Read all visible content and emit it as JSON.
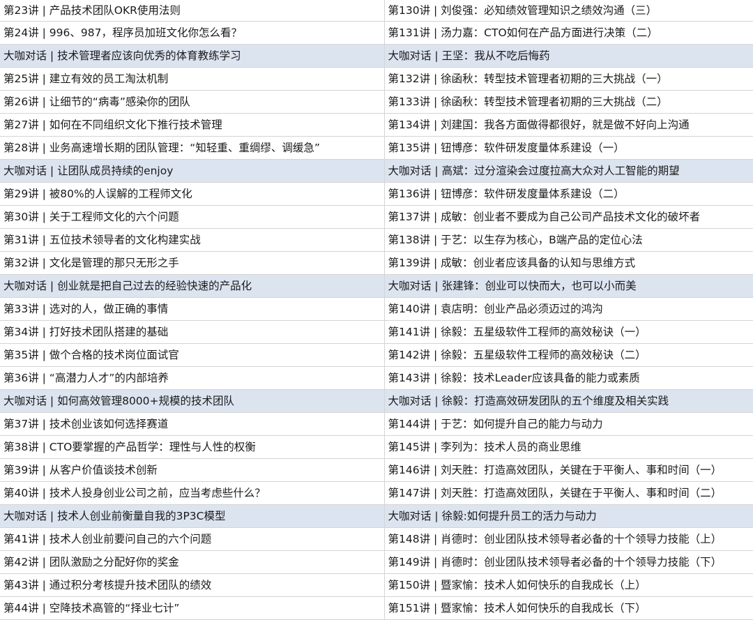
{
  "rows": [
    {
      "left": "第23讲 | 产品技术团队OKR使用法则",
      "right": "第130讲 | 刘俊强：必知绩效管理知识之绩效沟通（三）",
      "highlight": false
    },
    {
      "left": "第24讲 | 996、987，程序员加班文化你怎么看？",
      "right": "第131讲 | 汤力嘉：CTO如何在产品方面进行决策（二）",
      "highlight": false
    },
    {
      "left": "大咖对话 | 技术管理者应该向优秀的体育教练学习",
      "right": "大咖对话 | 王坚：我从不吃后悔药",
      "highlight": true
    },
    {
      "left": "第25讲 | 建立有效的员工淘汰机制",
      "right": "第132讲 | 徐函秋：转型技术管理者初期的三大挑战（一）",
      "highlight": false
    },
    {
      "left": "第26讲 | 让细节的“病毒”感染你的团队",
      "right": "第133讲 | 徐函秋：转型技术管理者初期的三大挑战（二）",
      "highlight": false
    },
    {
      "left": "第27讲 | 如何在不同组织文化下推行技术管理",
      "right": "第134讲 | 刘建国：我各方面做得都很好，就是做不好向上沟通",
      "highlight": false
    },
    {
      "left": "第28讲 | 业务高速增长期的团队管理：“知轻重、重绸缪、调缓急”",
      "right": "第135讲 | 钮博彦：软件研发度量体系建设（一）",
      "highlight": false
    },
    {
      "left": "大咖对话 | 让团队成员持续的enjoy",
      "right": "大咖对话 | 高斌：过分渲染会过度拉高大众对人工智能的期望",
      "highlight": true
    },
    {
      "left": "第29讲 | 被80%的人误解的工程师文化",
      "right": "第136讲 | 钮博彦：软件研发度量体系建设（二）",
      "highlight": false
    },
    {
      "left": "第30讲 | 关于工程师文化的六个问题",
      "right": "第137讲 | 成敏：创业者不要成为自己公司产品技术文化的破坏者",
      "highlight": false
    },
    {
      "left": "第31讲 | 五位技术领导者的文化构建实战",
      "right": "第138讲 | 于艺：以生存为核心，B端产品的定位心法",
      "highlight": false
    },
    {
      "left": "第32讲 | 文化是管理的那只无形之手",
      "right": "第139讲 | 成敏：创业者应该具备的认知与思维方式",
      "highlight": false
    },
    {
      "left": "大咖对话 | 创业就是把自己过去的经验快速的产品化",
      "right": "大咖对话 | 张建锋：创业可以快而大，也可以小而美",
      "highlight": true
    },
    {
      "left": "第33讲 | 选对的人，做正确的事情",
      "right": "第140讲 | 袁店明：创业产品必须迈过的鸿沟",
      "highlight": false
    },
    {
      "left": "第34讲 | 打好技术团队搭建的基础",
      "right": "第141讲 | 徐毅：五星级软件工程师的高效秘诀（一）",
      "highlight": false
    },
    {
      "left": "第35讲 | 做个合格的技术岗位面试官",
      "right": "第142讲 | 徐毅：五星级软件工程师的高效秘诀（二）",
      "highlight": false
    },
    {
      "left": "第36讲 | “高潜力人才”的内部培养",
      "right": "第143讲 | 徐毅：技术Leader应该具备的能力或素质",
      "highlight": false
    },
    {
      "left": "大咖对话 | 如何高效管理8000+规模的技术团队",
      "right": "大咖对话 | 徐毅：打造高效研发团队的五个维度及相关实践",
      "highlight": true
    },
    {
      "left": "第37讲 | 技术创业该如何选择赛道",
      "right": "第144讲 | 于艺：如何提升自己的能力与动力",
      "highlight": false
    },
    {
      "left": "第38讲 | CTO要掌握的产品哲学：理性与人性的权衡",
      "right": "第145讲 | 李列为：技术人员的商业思维",
      "highlight": false
    },
    {
      "left": "第39讲 | 从客户价值谈技术创新",
      "right": "第146讲 | 刘天胜：打造高效团队，关键在于平衡人、事和时间（一）",
      "highlight": false
    },
    {
      "left": "第40讲 | 技术人投身创业公司之前，应当考虑些什么？",
      "right": "第147讲 | 刘天胜：打造高效团队，关键在于平衡人、事和时间（二）",
      "highlight": false
    },
    {
      "left": "大咖对话 | 技术人创业前衡量自我的3P3C模型",
      "right": "大咖对话 | 徐毅:如何提升员工的活力与动力",
      "highlight": true
    },
    {
      "left": "第41讲 | 技术人创业前要问自己的六个问题",
      "right": "第148讲 | 肖德时：创业团队技术领导者必备的十个领导力技能（上）",
      "highlight": false
    },
    {
      "left": "第42讲 | 团队激励之分配好你的奖金",
      "right": "第149讲 | 肖德时：创业团队技术领导者必备的十个领导力技能（下）",
      "highlight": false
    },
    {
      "left": "第43讲 | 通过积分考核提升技术团队的绩效",
      "right": "第150讲 | 暨家愉：技术人如何快乐的自我成长（上）",
      "highlight": false
    },
    {
      "left": "第44讲 | 空降技术高管的“择业七计”",
      "right": "第151讲 | 暨家愉：技术人如何快乐的自我成长（下）",
      "highlight": false
    }
  ],
  "colors": {
    "highlight_row": "#dce4f0",
    "grid_line": "#d4d4d4",
    "text": "#1a1a1a"
  }
}
